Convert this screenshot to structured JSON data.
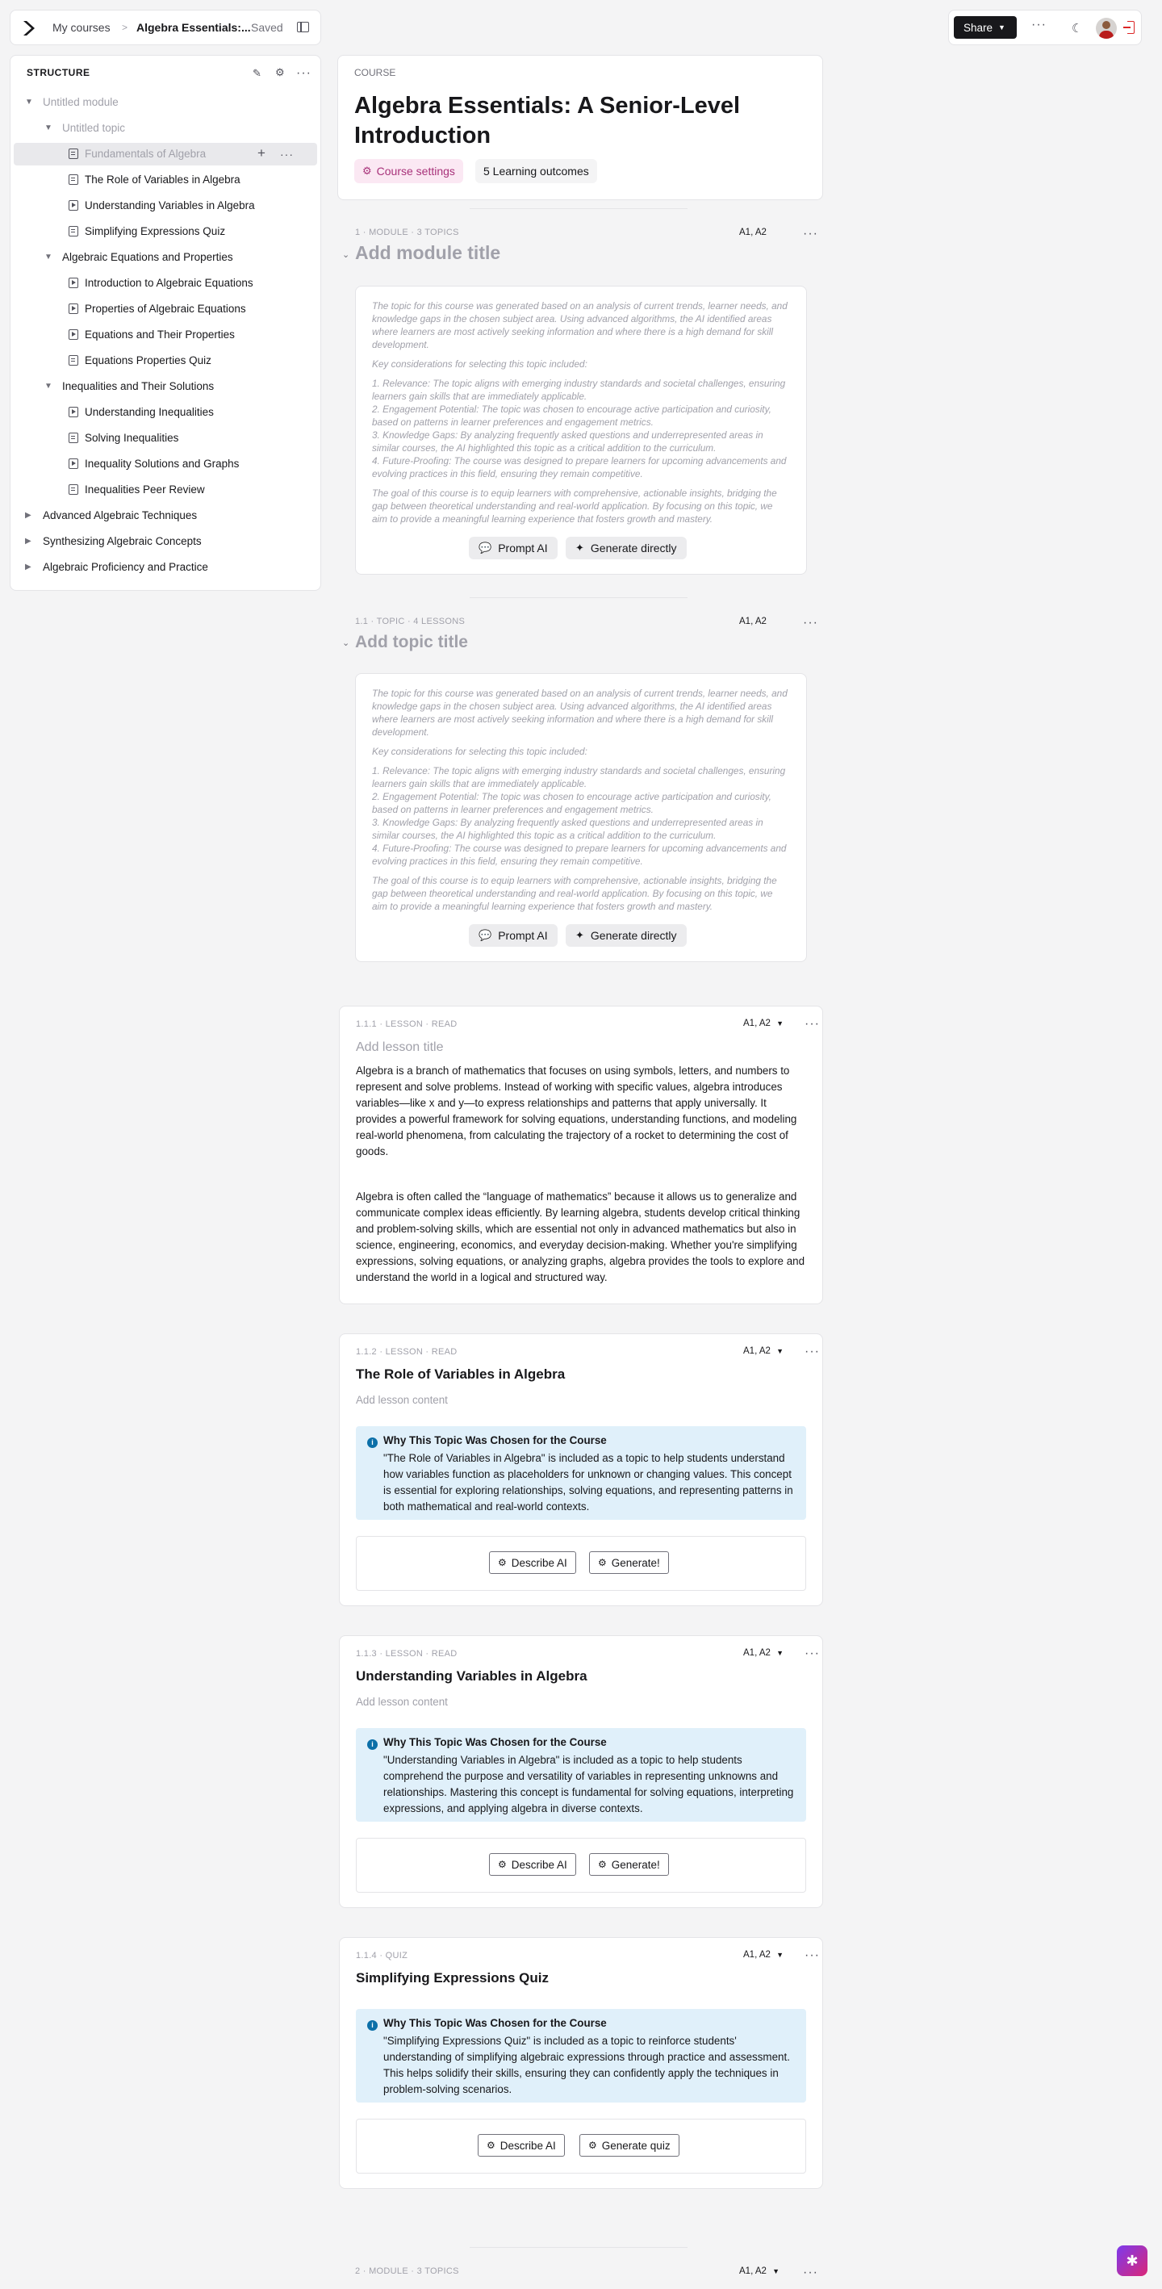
{
  "topbar": {
    "my_courses": "My courses",
    "separator": ">",
    "course_crumb": "Algebra Essentials:...",
    "saved": "Saved",
    "share": "Share"
  },
  "sidebar": {
    "title": "STRUCTURE",
    "rows": [
      {
        "label": "Untitled module",
        "level": 0,
        "type": "module",
        "expanded": true,
        "muted": true
      },
      {
        "label": "Untitled topic",
        "level": 1,
        "type": "topic",
        "expanded": true,
        "muted": true
      },
      {
        "label": "Fundamentals of Algebra",
        "level": 2,
        "type": "doc",
        "muted": true,
        "selected": true
      },
      {
        "label": "The Role of Variables in Algebra",
        "level": 2,
        "type": "doc"
      },
      {
        "label": "Understanding Variables in Algebra",
        "level": 2,
        "type": "video"
      },
      {
        "label": "Simplifying Expressions Quiz",
        "level": 2,
        "type": "quiz"
      },
      {
        "label": "Algebraic Equations and Properties",
        "level": 1,
        "type": "topic",
        "expanded": true
      },
      {
        "label": "Introduction to Algebraic Equations",
        "level": 2,
        "type": "video"
      },
      {
        "label": "Properties of Algebraic Equations",
        "level": 2,
        "type": "video"
      },
      {
        "label": "Equations and Their Properties",
        "level": 2,
        "type": "video"
      },
      {
        "label": "Equations Properties Quiz",
        "level": 2,
        "type": "quiz"
      },
      {
        "label": "Inequalities and Their Solutions",
        "level": 1,
        "type": "topic",
        "expanded": true
      },
      {
        "label": "Understanding Inequalities",
        "level": 2,
        "type": "video"
      },
      {
        "label": "Solving Inequalities",
        "level": 2,
        "type": "doc"
      },
      {
        "label": "Inequality Solutions and Graphs",
        "level": 2,
        "type": "video"
      },
      {
        "label": "Inequalities Peer Review",
        "level": 2,
        "type": "quiz"
      },
      {
        "label": "Advanced Algebraic Techniques",
        "level": 0,
        "type": "module",
        "expanded": false
      },
      {
        "label": "Synthesizing Algebraic Concepts",
        "level": 0,
        "type": "module",
        "expanded": false
      },
      {
        "label": "Algebraic Proficiency and Practice",
        "level": 0,
        "type": "module",
        "expanded": false
      }
    ]
  },
  "course": {
    "label": "COURSE",
    "title_line1": "Algebra Essentials: A Senior-Level",
    "title_line2": "Introduction",
    "settings": "Course settings",
    "outcomes": "5 Learning outcomes"
  },
  "module": {
    "meta": "1 · MODULE · 3 TOPICS",
    "levels": "A1, A2",
    "title_placeholder": "Add module title"
  },
  "topic": {
    "meta": "1.1 · TOPIC · 4 LESSONS",
    "levels": "A1, A2",
    "title_placeholder": "Add topic title"
  },
  "generated_text": {
    "p1": "The topic for this course was generated based on an analysis of current trends, learner needs, and knowledge gaps in the chosen subject area. Using advanced algorithms, the AI identified areas where learners are most actively seeking information and where there is a high demand for skill development.",
    "p2": "Key considerations for selecting this topic included:",
    "p3": "1. Relevance: The topic aligns with emerging industry standards and societal challenges, ensuring learners gain skills that are immediately applicable.",
    "p4": "2. Engagement Potential: The topic was chosen to encourage active participation and curiosity, based on patterns in learner preferences and engagement metrics.",
    "p5": "3. Knowledge Gaps: By analyzing frequently asked questions and underrepresented areas in similar courses, the AI highlighted this topic as a critical addition to the curriculum.",
    "p6": "4. Future-Proofing: The course was designed to prepare learners for upcoming advancements and evolving practices in this field, ensuring they remain competitive.",
    "p7": "The goal of this course is to equip learners with comprehensive, actionable insights, bridging the gap between theoretical understanding and real-world application. By focusing on this topic, we aim to provide a meaningful learning experience that fosters growth and mastery.",
    "prompt_ai": "Prompt AI",
    "generate_directly": "Generate directly"
  },
  "lesson1": {
    "meta": "1.1.1 · LESSON · READ",
    "levels": "A1, A2",
    "title_placeholder": "Add lesson title",
    "para1": "Algebra is a branch of mathematics that focuses on using symbols, letters, and numbers to represent and solve problems. Instead of working with specific values, algebra introduces variables—like x and y—to express relationships and patterns that apply universally. It provides a powerful framework for solving equations, understanding functions, and modeling real-world phenomena, from calculating the trajectory of a rocket to determining the cost of goods.",
    "para2": "Algebra is often called the “language of mathematics” because it allows us to generalize and communicate complex ideas efficiently. By learning algebra, students develop critical thinking and problem-solving skills, which are essential not only in advanced mathematics but also in science, engineering, economics, and everyday decision-making. Whether you're simplifying expressions, solving equations, or analyzing graphs, algebra provides the tools to explore and understand the world in a logical and structured way."
  },
  "lesson2": {
    "meta": "1.1.2 · LESSON · READ",
    "levels": "A1, A2",
    "title": "The Role of Variables in Algebra",
    "content_placeholder": "Add lesson content",
    "why_heading": "Why This Topic Was Chosen for the Course",
    "why_text": "\"The Role of Variables in Algebra\" is included as a topic to help students understand how variables function as placeholders for unknown or changing values. This concept is essential for exploring relationships, solving equations, and representing patterns in both mathematical and real-world contexts.",
    "btn1": "Describe AI",
    "btn2": "Generate!"
  },
  "lesson3": {
    "meta": "1.1.3 · LESSON · READ",
    "levels": "A1, A2",
    "title": "Understanding Variables in Algebra",
    "content_placeholder": "Add lesson content",
    "why_heading": "Why This Topic Was Chosen for the Course",
    "why_text": "\"Understanding Variables in Algebra\" is included as a topic to help students comprehend the purpose and versatility of variables in representing unknowns and relationships. Mastering this concept is fundamental for solving equations, interpreting expressions, and applying algebra in diverse contexts.",
    "btn1": "Describe AI",
    "btn2": "Generate!"
  },
  "lesson4": {
    "meta": "1.1.4 · QUIZ",
    "levels": "A1, A2",
    "title": "Simplifying Expressions Quiz",
    "why_heading": "Why This Topic Was Chosen for the Course",
    "why_text": "\"Simplifying Expressions Quiz\" is included as a topic to reinforce students' understanding of simplifying algebraic expressions through practice and assessment. This helps solidify their skills, ensuring they can confidently apply the techniques in problem-solving scenarios.",
    "btn1": "Describe AI",
    "btn2": "Generate quiz"
  },
  "module2": {
    "meta": "2 · MODULE · 3 TOPICS",
    "levels": "A1, A2"
  },
  "colors": {
    "accent_pink": "#a8327a",
    "info_blue": "#0b6fa8",
    "info_bg": "#e0f0fa"
  }
}
